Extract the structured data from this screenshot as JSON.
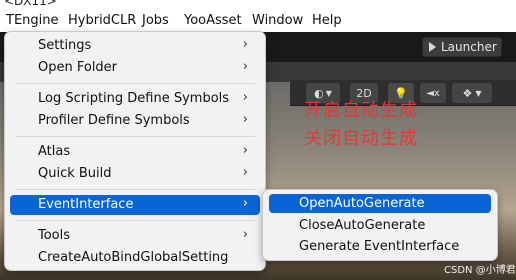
{
  "top_strip_text": "<DX11>",
  "menubar": {
    "items": [
      "TEngine",
      "HybridCLR",
      "Jobs",
      "YooAsset",
      "Window",
      "Help"
    ]
  },
  "toolbar": {
    "launcher_label": "Launcher",
    "toggle_2d_label": "2D"
  },
  "annotations": {
    "line1": "开启自动生成",
    "line2": "关闭自动生成",
    "color": "#e23a3a"
  },
  "menu": {
    "items": [
      {
        "label": "Settings",
        "has_submenu": true
      },
      {
        "label": "Open Folder",
        "has_submenu": true
      },
      {
        "label": "Log Scripting Define Symbols",
        "has_submenu": true
      },
      {
        "label": "Profiler Define Symbols",
        "has_submenu": true
      },
      {
        "label": "Atlas",
        "has_submenu": true
      },
      {
        "label": "Quick Build",
        "has_submenu": true
      },
      {
        "label": "EventInterface",
        "has_submenu": true,
        "highlighted": true
      },
      {
        "label": "Tools",
        "has_submenu": true
      },
      {
        "label": "CreateAutoBindGlobalSetting",
        "has_submenu": false
      }
    ],
    "arrow_glyph": "›",
    "highlight_color": "#0a64d6"
  },
  "submenu": {
    "items": [
      {
        "label": "OpenAutoGenerate",
        "highlighted": true
      },
      {
        "label": "CloseAutoGenerate"
      },
      {
        "label": "Generate EventInterface"
      }
    ]
  },
  "watermark": "CSDN @小博君"
}
